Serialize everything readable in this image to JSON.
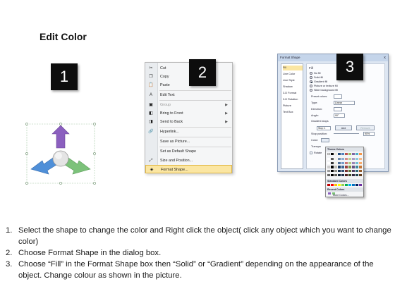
{
  "header": {
    "title": "Edit Color"
  },
  "steps_badges": [
    "1",
    "2",
    "3"
  ],
  "colors": {
    "badge_bg": "#0d0d0d",
    "arrow_purple": "#8b5fbf",
    "arrow_blue": "#4f8fd8",
    "arrow_green": "#7cc27a",
    "highlight": "#fbe6a2"
  },
  "context_menu": {
    "items": [
      {
        "label": "Cut",
        "icon": "scissors-icon",
        "glyph": "✂"
      },
      {
        "label": "Copy",
        "icon": "copy-icon",
        "glyph": "❐"
      },
      {
        "label": "Paste",
        "icon": "paste-icon",
        "glyph": "📋"
      },
      {
        "label": "Edit Text",
        "icon": "text-icon",
        "glyph": "A"
      },
      {
        "label": "Group",
        "icon": "group-icon",
        "glyph": "▣",
        "disabled": true,
        "submenu": true
      },
      {
        "label": "Bring to Front",
        "icon": "bring-front-icon",
        "glyph": "◧",
        "submenu": true
      },
      {
        "label": "Send to Back",
        "icon": "send-back-icon",
        "glyph": "◨",
        "submenu": true
      },
      {
        "label": "Hyperlink...",
        "icon": "hyperlink-icon",
        "glyph": "🔗"
      },
      {
        "label": "Save as Picture...",
        "icon": "",
        "glyph": ""
      },
      {
        "label": "Set as Default Shape",
        "icon": "",
        "glyph": ""
      },
      {
        "label": "Size and Position...",
        "icon": "size-position-icon",
        "glyph": "⤢"
      },
      {
        "label": "Format Shape...",
        "icon": "format-shape-icon",
        "glyph": "◈",
        "highlighted": true
      }
    ]
  },
  "format_dialog": {
    "title": "Format Shape",
    "close": "X",
    "nav": [
      "Fill",
      "Line Color",
      "Line Style",
      "Shadow",
      "3-D Format",
      "3-D Rotation",
      "Picture",
      "Text Box"
    ],
    "section": "Fill",
    "fill_options": [
      "No fill",
      "Solid fill",
      "Gradient fill",
      "Picture or texture fill",
      "Slide background fill"
    ],
    "fields": {
      "preset_colors": "Preset colors:",
      "type": "Type:",
      "type_value": "Linear",
      "direction": "Direction:",
      "angle": "Angle:",
      "angle_value": "90°",
      "gradient_stops": "Gradient stops",
      "stop": "Stop 1",
      "add": "Add",
      "remove": "Remove",
      "stop_position": "Stop position:",
      "stop_position_value": "90%",
      "color": "Color:",
      "transparency": "Transpa",
      "rotate": "Rotate"
    }
  },
  "color_popup": {
    "theme_label": "Theme Colors",
    "standard_label": "Standard Colors",
    "recent_label": "Recent Colors",
    "more": "More Colors..."
  },
  "instructions": [
    {
      "n": "1.",
      "text": "Select the shape to change the color and Right click the object( click any object which you want to change color)"
    },
    {
      "n": "2.",
      "text": "Choose Format Shape in the dialog box."
    },
    {
      "n": "3.",
      "text": "Choose “Fill” in the Format Shape box then “Solid” or “Gradient” depending on the appearance of the object. Change colour as shown in the picture."
    }
  ]
}
